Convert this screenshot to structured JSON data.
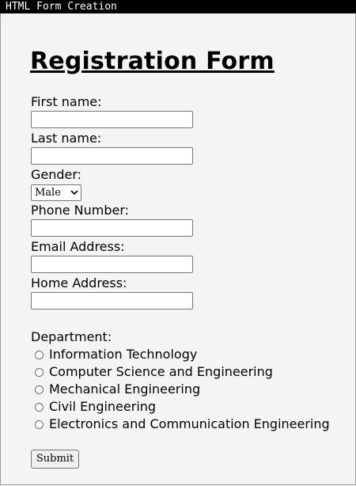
{
  "window": {
    "title": "HTML Form Creation"
  },
  "form": {
    "heading": "Registration Form",
    "first_name_label": "First name:",
    "last_name_label": "Last name:",
    "gender_label": "Gender:",
    "gender_selected": "Male",
    "phone_label": "Phone Number:",
    "email_label": "Email Address:",
    "home_address_label": "Home Address:",
    "department_label": "Department:",
    "departments": [
      "Information Technology",
      "Computer Science and Engineering",
      "Mechanical Engineering",
      "Civil Engineering",
      "Electronics and Communication Engineering"
    ],
    "submit_label": "Submit"
  }
}
